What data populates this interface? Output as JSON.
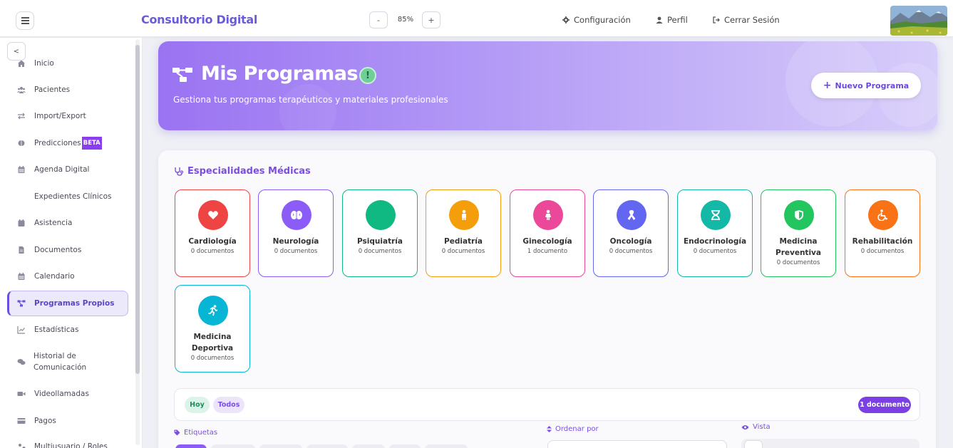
{
  "header": {
    "brand": "Consultorio Digital",
    "zoom_minus": "-",
    "zoom_value": "85%",
    "zoom_plus": "+",
    "config_label": "Configuración",
    "profile_label": "Perfil",
    "logout_label": "Cerrar Sesión"
  },
  "sidebar": {
    "collapse_label": "<",
    "beta": "BETA",
    "items": [
      {
        "label": "Inicio",
        "icon": "home-icon"
      },
      {
        "label": "Pacientes",
        "icon": "users-icon"
      },
      {
        "label": "Import/Export",
        "icon": "exchange-icon"
      },
      {
        "label": "Predicciones",
        "icon": "brain-icon"
      },
      {
        "label": "Agenda Digital",
        "icon": "calendar-icon"
      },
      {
        "label": "Expedientes Clínicos",
        "icon": ""
      },
      {
        "label": "Asistencia",
        "icon": "calendar-check-icon"
      },
      {
        "label": "Documentos",
        "icon": "file-icon"
      },
      {
        "label": "Calendario",
        "icon": "calendar-icon"
      },
      {
        "label": "Programas Propios",
        "icon": "project-diagram-icon"
      },
      {
        "label": "Estadísticas",
        "icon": "chart-line-icon"
      },
      {
        "label": "Historial de",
        "label2": "Comunicación",
        "icon": "comments-icon"
      },
      {
        "label": "Videollamadas",
        "icon": "video-icon"
      },
      {
        "label": "Pagos",
        "icon": "credit-card-icon"
      },
      {
        "label": "Multiusuario / Roles",
        "icon": "users-cog-icon"
      }
    ]
  },
  "hero": {
    "title": "Mis Programas",
    "badge": "!",
    "subtitle": "Gestiona tus programas terapéuticos y materiales profesionales",
    "new_button": "Nuevo Programa"
  },
  "specialties": {
    "title": "Especialidades Médicas",
    "items": [
      {
        "name": "Cardiología",
        "count": "0 documentos",
        "color": "#ef4444",
        "icon": "heart-icon"
      },
      {
        "name": "Neurología",
        "count": "0 documentos",
        "color": "#8b5cf6",
        "icon": "brain-icon"
      },
      {
        "name": "Psiquiatría",
        "count": "0 documentos",
        "color": "#10b981",
        "icon": "head-icon"
      },
      {
        "name": "Pediatría",
        "count": "0 documentos",
        "color": "#f59e0b",
        "icon": "child-icon"
      },
      {
        "name": "Ginecología",
        "count": "1 documento",
        "color": "#ec4899",
        "icon": "female-icon"
      },
      {
        "name": "Oncología",
        "count": "0 documentos",
        "color": "#6366f1",
        "icon": "ribbon-icon"
      },
      {
        "name": "Endocrinología",
        "count": "0 documentos",
        "color": "#14b8a6",
        "icon": "dna-icon"
      },
      {
        "name": "Medicina",
        "name2": "Preventiva",
        "count": "0 documentos",
        "color": "#22c55e",
        "icon": "shield-icon"
      },
      {
        "name": "Rehabilitación",
        "count": "0 documentos",
        "color": "#f97316",
        "icon": "wheelchair-icon"
      },
      {
        "name": "Medicina",
        "name2": "Deportiva",
        "count": "0 documentos",
        "color": "#06b6d4",
        "icon": "running-icon"
      }
    ]
  },
  "filters": {
    "today": "Hoy",
    "all": "Todos",
    "doc_count": "1 documento",
    "tags_label": "Etiquetas",
    "sort_label": "Ordenar por",
    "view_label": "Vista"
  }
}
